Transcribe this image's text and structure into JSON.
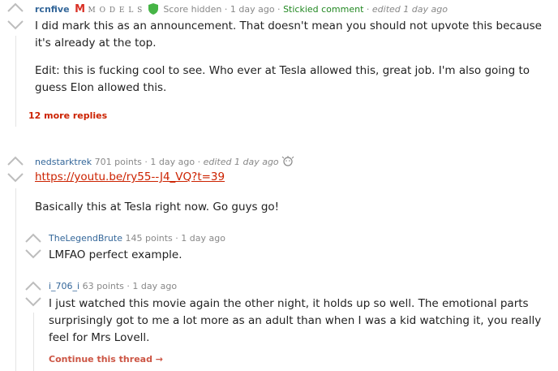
{
  "comments": [
    {
      "author": "rcnfive",
      "flair": "M O D E L S",
      "score": "Score hidden",
      "time": "1 day ago",
      "stickied": "Stickied comment",
      "edited": "edited 1 day ago",
      "paragraphs": [
        "I did mark this as an announcement. That doesn't mean you should not upvote this because it's already at the top.",
        "Edit: this is fucking cool to see. Who ever at Tesla allowed this, great job. I'm also going to guess Elon allowed this."
      ],
      "more_replies": "12 more replies"
    },
    {
      "author": "nedstarktrek",
      "points": "701 points",
      "time": "1 day ago",
      "edited": "edited 1 day ago",
      "award_icon": "gold-award-icon",
      "link": "https://youtu.be/ry55--J4_VQ?t=39",
      "text": "Basically this at Tesla right now. Go guys go!"
    },
    {
      "author": "TheLegendBrute",
      "points": "145 points",
      "time": "1 day ago",
      "text": "LMFAO perfect example."
    },
    {
      "author": "i_706_i",
      "points": "63 points",
      "time": "1 day ago",
      "text": "I just watched this movie again the other night, it holds up so well. The emotional parts surprisingly got to me a lot more as an adult than when I was a kid watching it, you really feel for Mrs Lovell.",
      "continue": "Continue this thread →"
    }
  ],
  "colors": {
    "link": "#cc2200",
    "stickied": "#228822",
    "author": "#336699",
    "flair_accent": "#d93025",
    "shield": "#46b446"
  }
}
